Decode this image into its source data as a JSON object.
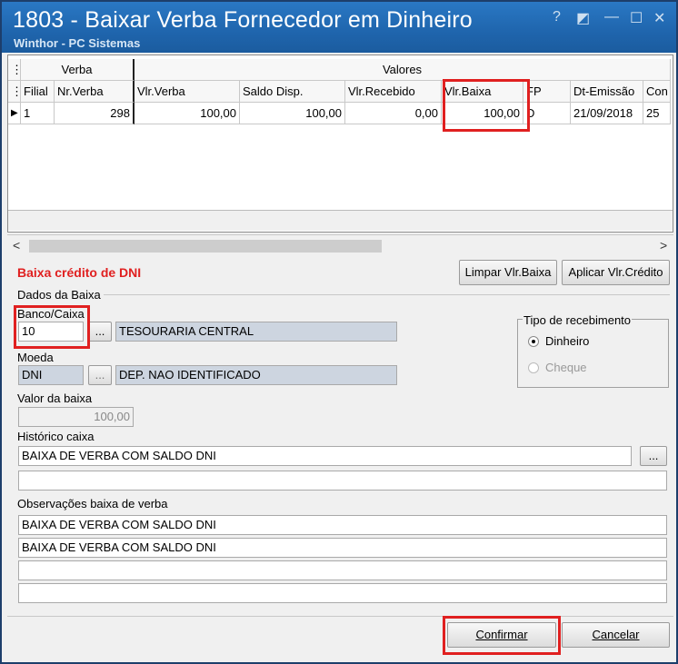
{
  "window": {
    "title": "1803 - Baixar Verba Fornecedor em Dinheiro",
    "subtitle": "Winthor - PC Sistemas",
    "help_glyph": "?",
    "restore_glyph": "◩",
    "minimize_glyph": "—",
    "maximize_glyph": "☐",
    "close_glyph": "✕"
  },
  "grid": {
    "group_headers": [
      "Verba",
      "Valores"
    ],
    "columns": [
      "Filial",
      "Nr.Verba",
      "Vlr.Verba",
      "Saldo Disp.",
      "Vlr.Recebido",
      "Vlr.Baixa",
      "FP",
      "Dt-Emissão",
      "Con"
    ],
    "rows": [
      {
        "indicator": "▶",
        "cells": [
          "1",
          "298",
          "100,00",
          "100,00",
          "0,00",
          "100,00",
          "D",
          "21/09/2018",
          "25"
        ]
      }
    ],
    "scroll_left": "<",
    "scroll_right": ">"
  },
  "section": {
    "title": "Baixa crédito de DNI",
    "limpar_button": "Limpar Vlr.Baixa",
    "aplicar_button": "Aplicar Vlr.Crédito",
    "dados_label": "Dados da Baixa"
  },
  "form": {
    "banco_label": "Banco/Caixa",
    "banco_value": "10",
    "banco_desc": "TESOURARIA CENTRAL",
    "lookup_glyph": "...",
    "moeda_label": "Moeda",
    "moeda_value": "DNI",
    "moeda_desc": "DEP. NAO IDENTIFICADO",
    "valor_label": "Valor da baixa",
    "valor_value": "100,00",
    "historico_label": "Histórico caixa",
    "historico_lines": [
      "BAIXA DE VERBA COM SALDO DNI",
      ""
    ],
    "obs_label": "Observações baixa de verba",
    "obs_lines": [
      "BAIXA DE VERBA COM SALDO DNI",
      "BAIXA DE VERBA COM SALDO DNI",
      "",
      ""
    ]
  },
  "tipo_recebimento": {
    "label": "Tipo de recebimento",
    "options": [
      {
        "label": "Dinheiro",
        "selected": true,
        "enabled": true
      },
      {
        "label": "Cheque",
        "selected": false,
        "enabled": false
      }
    ]
  },
  "footer": {
    "confirmar": "Confirmar",
    "cancelar": "Cancelar"
  },
  "colors": {
    "title_bar": "#1f65ad",
    "highlight": "#e02020",
    "section_title": "#e02020",
    "readonly_field": "#cdd5e0"
  }
}
